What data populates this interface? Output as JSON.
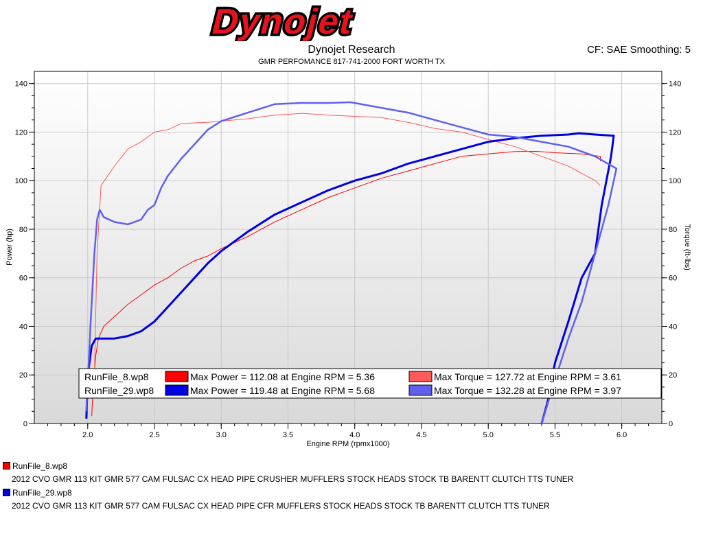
{
  "brand": {
    "logo_text": "Dynojet"
  },
  "header": {
    "title": "Dynojet Research",
    "subtitle": "GMR PERFOMANCE 817-741-2000  FORT WORTH TX",
    "correction": "CF: SAE Smoothing: 5"
  },
  "chart_data": {
    "type": "line",
    "xlabel": "Engine RPM (rpmx1000)",
    "ylabel_left": "Power (hp)",
    "ylabel_right": "Torque (ft-lbs)",
    "xlim": [
      1.6,
      6.3
    ],
    "ylim": [
      0,
      145
    ],
    "x_ticks": [
      "2.0",
      "2.5",
      "3.0",
      "3.5",
      "4.0",
      "4.5",
      "5.0",
      "5.5",
      "6.0"
    ],
    "y_ticks": [
      "0",
      "20",
      "40",
      "60",
      "80",
      "100",
      "120",
      "140"
    ],
    "grid": true,
    "series": [
      {
        "name": "RunFile_8.wp8",
        "measure": "Power",
        "color": "#ff0000",
        "x": [
          2.03,
          2.04,
          2.06,
          2.08,
          2.12,
          2.2,
          2.3,
          2.4,
          2.5,
          2.6,
          2.7,
          2.8,
          2.9,
          3.0,
          3.2,
          3.4,
          3.6,
          3.8,
          4.0,
          4.2,
          4.4,
          4.6,
          4.8,
          5.0,
          5.2,
          5.36,
          5.5,
          5.7,
          5.84,
          5.84
        ],
        "y": [
          3,
          15,
          28,
          35,
          40,
          44,
          49,
          53,
          57,
          60,
          64,
          67,
          69,
          72,
          77,
          83,
          88,
          93,
          97,
          101,
          104,
          107,
          110,
          111,
          112,
          112.08,
          111.5,
          111,
          110,
          108
        ]
      },
      {
        "name": "RunFile_8.wp8",
        "measure": "Torque",
        "color": "#ff5a5a",
        "x": [
          2.05,
          2.07,
          2.1,
          2.2,
          2.3,
          2.4,
          2.5,
          2.6,
          2.7,
          2.8,
          2.9,
          3.0,
          3.2,
          3.4,
          3.61,
          3.8,
          4.0,
          4.2,
          4.4,
          4.6,
          4.8,
          5.0,
          5.2,
          5.4,
          5.6,
          5.8,
          5.84
        ],
        "y": [
          20,
          70,
          98,
          106,
          113,
          116,
          120,
          121,
          123.5,
          123.8,
          124,
          124.5,
          125.5,
          127,
          127.72,
          127,
          126.5,
          126,
          124,
          121.5,
          120,
          117,
          114,
          110,
          106,
          100,
          98
        ]
      },
      {
        "name": "RunFile_29.wp8",
        "measure": "Power",
        "color": "#0000e0",
        "x": [
          1.99,
          2.0,
          2.03,
          2.06,
          2.1,
          2.2,
          2.3,
          2.4,
          2.45,
          2.5,
          2.6,
          2.7,
          2.8,
          2.9,
          3.0,
          3.2,
          3.4,
          3.6,
          3.8,
          4.0,
          4.2,
          4.4,
          4.6,
          4.8,
          5.0,
          5.2,
          5.4,
          5.6,
          5.68,
          5.8,
          5.94,
          5.92,
          5.85,
          5.8,
          5.75,
          5.7,
          5.6,
          5.5,
          5.45,
          5.4
        ],
        "y": [
          2,
          20,
          32,
          35,
          35,
          35,
          36,
          38,
          40,
          42,
          48,
          54,
          60,
          66,
          71,
          79,
          86,
          91,
          96,
          100,
          103,
          107,
          110,
          113,
          116,
          117.5,
          118.5,
          119,
          119.48,
          119,
          118.5,
          110,
          90,
          70,
          65,
          60,
          42,
          25,
          10,
          0
        ]
      },
      {
        "name": "RunFile_29.wp8",
        "measure": "Torque",
        "color": "#6060f0",
        "x": [
          1.99,
          2.02,
          2.05,
          2.07,
          2.09,
          2.12,
          2.2,
          2.3,
          2.4,
          2.45,
          2.5,
          2.55,
          2.6,
          2.7,
          2.8,
          2.9,
          3.0,
          3.2,
          3.4,
          3.6,
          3.8,
          3.97,
          4.2,
          4.4,
          4.6,
          4.8,
          5.0,
          5.2,
          5.4,
          5.6,
          5.8,
          5.96,
          5.9,
          5.8,
          5.7,
          5.6,
          5.5,
          5.4
        ],
        "y": [
          5,
          40,
          70,
          84,
          88,
          85,
          83,
          82,
          84,
          88,
          90,
          97,
          102,
          109,
          115,
          121,
          124.5,
          128,
          131.5,
          132,
          132,
          132.28,
          130,
          128,
          125,
          122,
          119,
          118,
          116,
          114,
          110,
          105,
          90,
          70,
          50,
          35,
          18,
          0
        ]
      }
    ],
    "legend": {
      "placement": "bottom-left",
      "rows": [
        {
          "file": "RunFile_8.wp8",
          "power_color": "#ff0000",
          "power_text": "Max Power = 112.08 at Engine RPM = 5.36",
          "torque_color": "#ff5a5a",
          "torque_text": "Max Torque = 127.72 at Engine RPM = 3.61"
        },
        {
          "file": "RunFile_29.wp8",
          "power_color": "#0000e0",
          "power_text": "Max Power = 119.48 at Engine RPM = 5.68",
          "torque_color": "#6060f0",
          "torque_text": "Max Torque = 132.28 at Engine RPM = 3.97"
        }
      ]
    }
  },
  "runs": [
    {
      "file": "RunFile_8.wp8",
      "color": "#ff0000",
      "description": "2012  CVO  GMR  113  KIT  GMR  577  CAM  FULSAC  CX  HEAD  PIPE  CRUSHER  MUFFLERS  STOCK  HEADS  STOCK  TB  BARENTT  CLUTCH  TTS  TUNER"
    },
    {
      "file": "RunFile_29.wp8",
      "color": "#0000e0",
      "description": "2012  CVO  GMR  113  KIT  GMR  577  CAM  FULSAC  CX  HEAD  PIPE  CFR   MUFFLERS  STOCK  HEADS  STOCK  TB  BARENTT  CLUTCH  TTS  TUNER"
    }
  ]
}
